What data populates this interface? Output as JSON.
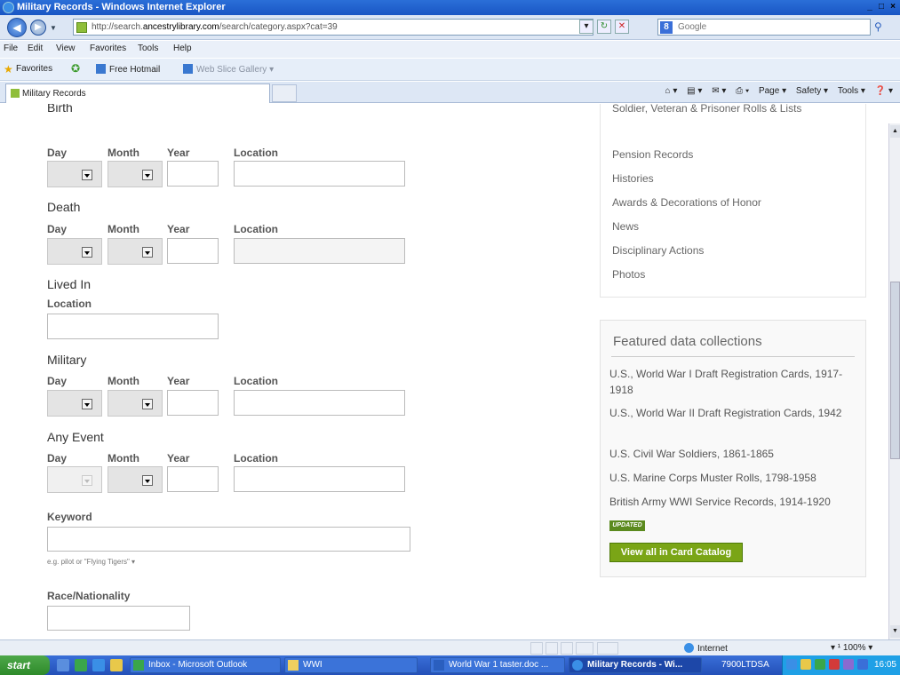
{
  "window": {
    "title": "Military Records - Windows Internet Explorer",
    "buttons": [
      "_",
      "□",
      "×"
    ]
  },
  "address": {
    "url_prefix": "http://search.",
    "url_domain": "ancestrylibrary.com",
    "url_suffix": "/search/category.aspx?cat=39",
    "search_placeholder": "Google"
  },
  "menu": [
    "File",
    "Edit",
    "View",
    "Favorites",
    "Tools",
    "Help"
  ],
  "favorites_bar": {
    "favorites_label": "Favorites",
    "hotmail": "Free Hotmail",
    "slice_gallery": "Web Slice Gallery ▾"
  },
  "tabs": [
    {
      "label": "Military Records"
    }
  ],
  "command_bar": [
    "Page ▾",
    "Safety ▾",
    "Tools ▾"
  ],
  "form": {
    "birth": {
      "title": "Birth",
      "day": "Day",
      "month": "Month",
      "year": "Year",
      "location": "Location"
    },
    "death": {
      "title": "Death",
      "day": "Day",
      "month": "Month",
      "year": "Year",
      "location": "Location"
    },
    "lived_in": {
      "title": "Lived In",
      "location": "Location"
    },
    "military": {
      "title": "Military",
      "day": "Day",
      "month": "Month",
      "year": "Year",
      "location": "Location"
    },
    "any_event": {
      "title": "Any Event",
      "day": "Day",
      "month": "Month",
      "year": "Year",
      "location": "Location"
    },
    "keyword": {
      "label": "Keyword",
      "hint": "e.g. pilot or \"Flying Tigers\" ▾"
    },
    "race": {
      "label": "Race/Nationality"
    }
  },
  "sidebar": {
    "links": [
      "Soldier, Veteran & Prisoner Rolls & Lists",
      "Pension Records",
      "Histories",
      "Awards & Decorations of Honor",
      "News",
      "Disciplinary Actions",
      "Photos"
    ],
    "featured": {
      "title": "Featured data collections",
      "items": [
        "U.S., World War I Draft Registration Cards, 1917-1918",
        "U.S., World War II Draft Registration Cards, 1942",
        "U.S. Civil War Soldiers, 1861-1865",
        "U.S. Marine Corps Muster Rolls, 1798-1958",
        "British Army WWI Service Records, 1914-1920"
      ],
      "badge": "UPDATED",
      "button": "View all in Card Catalog"
    }
  },
  "status": {
    "zone": "Internet",
    "zoom": "▾ ¹ 100% ▾"
  },
  "taskbar": {
    "start": "start",
    "tasks": [
      {
        "label": "Inbox - Microsoft Outlook"
      },
      {
        "label": "WWI"
      },
      {
        "label": "World War 1 taster.doc ..."
      },
      {
        "label": "Military Records - Wi..."
      }
    ],
    "tray_text": "7900LTDSA",
    "clock": "16:05"
  }
}
